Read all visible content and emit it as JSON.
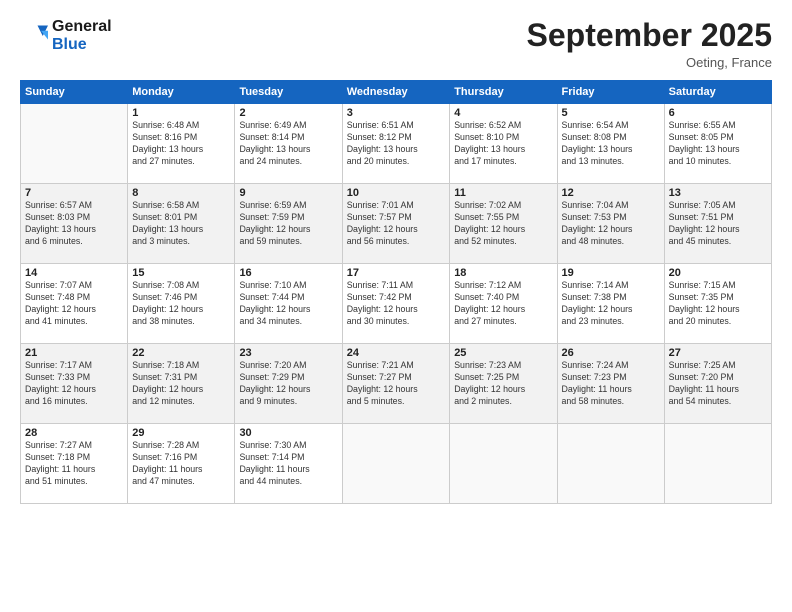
{
  "header": {
    "logo_line1": "General",
    "logo_line2": "Blue",
    "month": "September 2025",
    "location": "Oeting, France"
  },
  "weekdays": [
    "Sunday",
    "Monday",
    "Tuesday",
    "Wednesday",
    "Thursday",
    "Friday",
    "Saturday"
  ],
  "weeks": [
    [
      {
        "day": "",
        "info": ""
      },
      {
        "day": "1",
        "info": "Sunrise: 6:48 AM\nSunset: 8:16 PM\nDaylight: 13 hours\nand 27 minutes."
      },
      {
        "day": "2",
        "info": "Sunrise: 6:49 AM\nSunset: 8:14 PM\nDaylight: 13 hours\nand 24 minutes."
      },
      {
        "day": "3",
        "info": "Sunrise: 6:51 AM\nSunset: 8:12 PM\nDaylight: 13 hours\nand 20 minutes."
      },
      {
        "day": "4",
        "info": "Sunrise: 6:52 AM\nSunset: 8:10 PM\nDaylight: 13 hours\nand 17 minutes."
      },
      {
        "day": "5",
        "info": "Sunrise: 6:54 AM\nSunset: 8:08 PM\nDaylight: 13 hours\nand 13 minutes."
      },
      {
        "day": "6",
        "info": "Sunrise: 6:55 AM\nSunset: 8:05 PM\nDaylight: 13 hours\nand 10 minutes."
      }
    ],
    [
      {
        "day": "7",
        "info": "Sunrise: 6:57 AM\nSunset: 8:03 PM\nDaylight: 13 hours\nand 6 minutes."
      },
      {
        "day": "8",
        "info": "Sunrise: 6:58 AM\nSunset: 8:01 PM\nDaylight: 13 hours\nand 3 minutes."
      },
      {
        "day": "9",
        "info": "Sunrise: 6:59 AM\nSunset: 7:59 PM\nDaylight: 12 hours\nand 59 minutes."
      },
      {
        "day": "10",
        "info": "Sunrise: 7:01 AM\nSunset: 7:57 PM\nDaylight: 12 hours\nand 56 minutes."
      },
      {
        "day": "11",
        "info": "Sunrise: 7:02 AM\nSunset: 7:55 PM\nDaylight: 12 hours\nand 52 minutes."
      },
      {
        "day": "12",
        "info": "Sunrise: 7:04 AM\nSunset: 7:53 PM\nDaylight: 12 hours\nand 48 minutes."
      },
      {
        "day": "13",
        "info": "Sunrise: 7:05 AM\nSunset: 7:51 PM\nDaylight: 12 hours\nand 45 minutes."
      }
    ],
    [
      {
        "day": "14",
        "info": "Sunrise: 7:07 AM\nSunset: 7:48 PM\nDaylight: 12 hours\nand 41 minutes."
      },
      {
        "day": "15",
        "info": "Sunrise: 7:08 AM\nSunset: 7:46 PM\nDaylight: 12 hours\nand 38 minutes."
      },
      {
        "day": "16",
        "info": "Sunrise: 7:10 AM\nSunset: 7:44 PM\nDaylight: 12 hours\nand 34 minutes."
      },
      {
        "day": "17",
        "info": "Sunrise: 7:11 AM\nSunset: 7:42 PM\nDaylight: 12 hours\nand 30 minutes."
      },
      {
        "day": "18",
        "info": "Sunrise: 7:12 AM\nSunset: 7:40 PM\nDaylight: 12 hours\nand 27 minutes."
      },
      {
        "day": "19",
        "info": "Sunrise: 7:14 AM\nSunset: 7:38 PM\nDaylight: 12 hours\nand 23 minutes."
      },
      {
        "day": "20",
        "info": "Sunrise: 7:15 AM\nSunset: 7:35 PM\nDaylight: 12 hours\nand 20 minutes."
      }
    ],
    [
      {
        "day": "21",
        "info": "Sunrise: 7:17 AM\nSunset: 7:33 PM\nDaylight: 12 hours\nand 16 minutes."
      },
      {
        "day": "22",
        "info": "Sunrise: 7:18 AM\nSunset: 7:31 PM\nDaylight: 12 hours\nand 12 minutes."
      },
      {
        "day": "23",
        "info": "Sunrise: 7:20 AM\nSunset: 7:29 PM\nDaylight: 12 hours\nand 9 minutes."
      },
      {
        "day": "24",
        "info": "Sunrise: 7:21 AM\nSunset: 7:27 PM\nDaylight: 12 hours\nand 5 minutes."
      },
      {
        "day": "25",
        "info": "Sunrise: 7:23 AM\nSunset: 7:25 PM\nDaylight: 12 hours\nand 2 minutes."
      },
      {
        "day": "26",
        "info": "Sunrise: 7:24 AM\nSunset: 7:23 PM\nDaylight: 11 hours\nand 58 minutes."
      },
      {
        "day": "27",
        "info": "Sunrise: 7:25 AM\nSunset: 7:20 PM\nDaylight: 11 hours\nand 54 minutes."
      }
    ],
    [
      {
        "day": "28",
        "info": "Sunrise: 7:27 AM\nSunset: 7:18 PM\nDaylight: 11 hours\nand 51 minutes."
      },
      {
        "day": "29",
        "info": "Sunrise: 7:28 AM\nSunset: 7:16 PM\nDaylight: 11 hours\nand 47 minutes."
      },
      {
        "day": "30",
        "info": "Sunrise: 7:30 AM\nSunset: 7:14 PM\nDaylight: 11 hours\nand 44 minutes."
      },
      {
        "day": "",
        "info": ""
      },
      {
        "day": "",
        "info": ""
      },
      {
        "day": "",
        "info": ""
      },
      {
        "day": "",
        "info": ""
      }
    ]
  ]
}
